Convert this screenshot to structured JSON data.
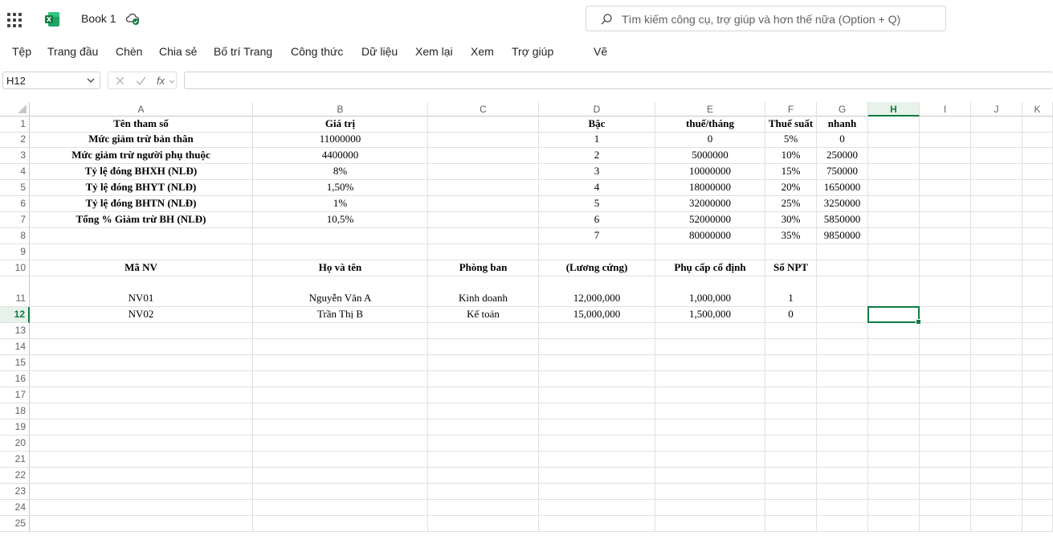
{
  "app": {
    "title": "Book 1",
    "accent": "#107c41"
  },
  "search": {
    "placeholder": "Tìm kiếm công cụ, trợ giúp và hơn thế nữa (Option + Q)"
  },
  "ribbon": {
    "tabs": [
      "Tệp",
      "Trang đầu",
      "Chèn",
      "Chia sẻ",
      "Bố trí Trang",
      "Công thức",
      "Dữ liệu",
      "Xem lại",
      "Xem",
      "Trợ giúp",
      "Vẽ"
    ]
  },
  "formula_bar": {
    "name_box": "H12",
    "fx": "fx",
    "value": ""
  },
  "columns": [
    "A",
    "B",
    "C",
    "D",
    "E",
    "F",
    "G",
    "H",
    "I",
    "J",
    "K"
  ],
  "rows": [
    "1",
    "2",
    "3",
    "4",
    "5",
    "6",
    "7",
    "8",
    "9",
    "10",
    "11",
    "12",
    "13",
    "14",
    "15",
    "16",
    "17",
    "18",
    "19",
    "20",
    "21",
    "22",
    "23",
    "24",
    "25"
  ],
  "selected": {
    "col": "H",
    "row": "12"
  },
  "sheet": {
    "row1": {
      "A": "Tên tham số",
      "B": "Giá trị",
      "D": "Bậc",
      "E": "Thu nhập tính thuế/tháng",
      "F": "Thuế suất",
      "G": "Số trừ nhanh"
    },
    "row2": {
      "A": "Mức giảm trừ bản thân",
      "B": "11000000",
      "D": "1",
      "E": "0",
      "F": "5%",
      "G": "0"
    },
    "row3": {
      "A": "Mức giảm trừ người phụ thuộc",
      "B": "4400000",
      "D": "2",
      "E": "5000000",
      "F": "10%",
      "G": "250000"
    },
    "row4": {
      "A": "Tỷ lệ đóng BHXH (NLĐ)",
      "B": "8%",
      "D": "3",
      "E": "10000000",
      "F": "15%",
      "G": "750000"
    },
    "row5": {
      "A": "Tỷ lệ đóng BHYT (NLĐ)",
      "B": "1,50%",
      "D": "4",
      "E": "18000000",
      "F": "20%",
      "G": "1650000"
    },
    "row6": {
      "A": "Tỷ lệ đóng BHTN (NLĐ)",
      "B": "1%",
      "D": "5",
      "E": "32000000",
      "F": "25%",
      "G": "3250000"
    },
    "row7": {
      "A": "Tổng % Giảm trừ BH (NLĐ)",
      "B": "10,5%",
      "D": "6",
      "E": "52000000",
      "F": "30%",
      "G": "5850000"
    },
    "row8": {
      "D": "7",
      "E": "80000000",
      "F": "35%",
      "G": "9850000"
    },
    "row10": {
      "A": "Mã NV",
      "B": "Họ và tên",
      "C": "Phòng ban",
      "D": "Lương thỏa thuận (Lương cứng)",
      "E": "Phụ cấp cố định",
      "F": "Số NPT"
    },
    "row11": {
      "A": "NV01",
      "B": "Nguyễn Văn A",
      "C": "Kinh doanh",
      "D": "12,000,000",
      "E": "1,000,000",
      "F": "1"
    },
    "row12": {
      "A": "NV02",
      "B": "Trần Thị B",
      "C": "Kế toán",
      "D": "15,000,000",
      "E": "1,500,000",
      "F": "0"
    }
  }
}
